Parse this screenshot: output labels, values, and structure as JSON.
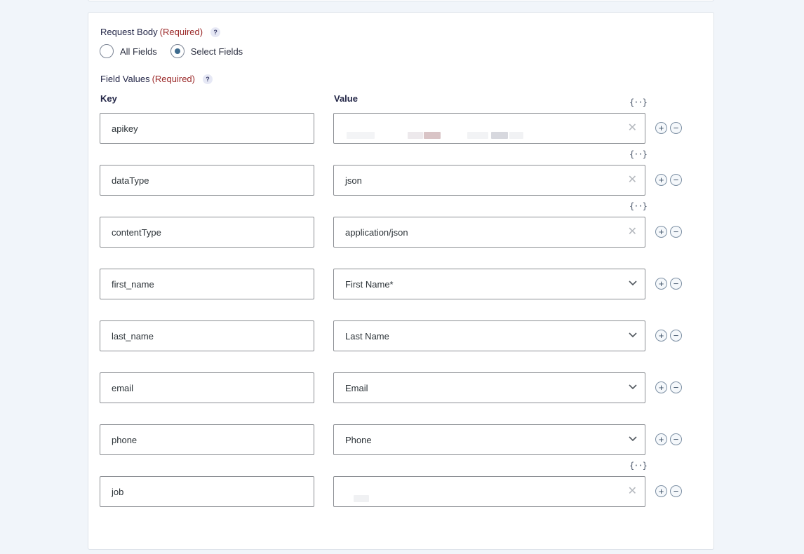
{
  "request_body": {
    "label": "Request Body",
    "required": "(Required)",
    "help": "?",
    "options": [
      "All Fields",
      "Select Fields"
    ],
    "selected": "Select Fields"
  },
  "field_values": {
    "label": "Field Values",
    "required": "(Required)",
    "help": "?"
  },
  "columns": {
    "key": "Key",
    "value": "Value"
  },
  "merge_tag": "{··}",
  "clear_symbol": "✕",
  "plus_symbol": "+",
  "minus_symbol": "−",
  "rows": [
    {
      "key": "apikey",
      "value": "",
      "value_kind": "text-redacted"
    },
    {
      "key": "dataType",
      "value": "json",
      "value_kind": "text"
    },
    {
      "key": "contentType",
      "value": "application/json",
      "value_kind": "text"
    },
    {
      "key": "first_name",
      "value": "First Name*",
      "value_kind": "select"
    },
    {
      "key": "last_name",
      "value": "Last Name",
      "value_kind": "select"
    },
    {
      "key": "email",
      "value": "Email",
      "value_kind": "select"
    },
    {
      "key": "phone",
      "value": "Phone",
      "value_kind": "select"
    },
    {
      "key": "job",
      "value": "",
      "value_kind": "text-redacted"
    }
  ]
}
